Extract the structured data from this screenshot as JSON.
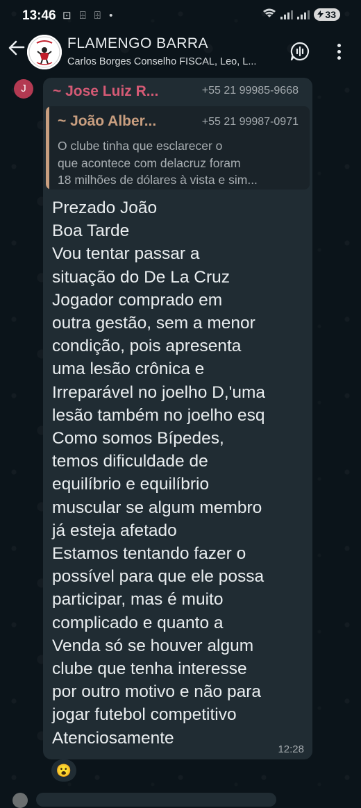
{
  "status_bar": {
    "time": "13:46",
    "notif_icons": "⊡ ⌹ ⌹ •",
    "battery": "33"
  },
  "header": {
    "title": "FLAMENGO BARRA",
    "subtitle": "Carlos Borges Conselho FISCAL, Leo, L..."
  },
  "message": {
    "avatar_letter": "J",
    "sender_name": "~ Jose Luiz R...",
    "sender_phone": "+55 21 99985-9668",
    "quoted": {
      "name": "~ João Alber...",
      "phone": "+55 21 99987-0971",
      "lines": [
        "O clube tinha que esclarecer o",
        "que acontece com delacruz foram",
        "18 milhões de dólares à vista e sim..."
      ]
    },
    "body_lines": [
      "Prezado João",
      "Boa Tarde",
      "Vou tentar passar a",
      "situação do De La Cruz",
      "Jogador comprado em",
      "outra gestão, sem a menor",
      "condição, pois apresenta",
      "uma lesão crônica e",
      "Irreparável no joelho D,'uma",
      "lesão também no joelho esq",
      "Como somos Bípedes,",
      "temos dificuldade de",
      "equilíbrio e equilíbrio",
      "muscular se algum membro",
      "já esteja afetado",
      "Estamos tentando fazer o",
      "possível para que ele possa",
      "participar, mas é muito",
      "complicado e quanto a",
      "Venda só se houver algum",
      "clube que tenha interesse",
      "por outro motivo e não para",
      "jogar futebol competitivo",
      "Atenciosamente"
    ],
    "time": "12:28",
    "reaction": "😮"
  },
  "colors": {
    "background": "#0b141a",
    "bubble": "#202c33",
    "sender_name": "#d55a75",
    "quote_accent": "#c99f80"
  }
}
